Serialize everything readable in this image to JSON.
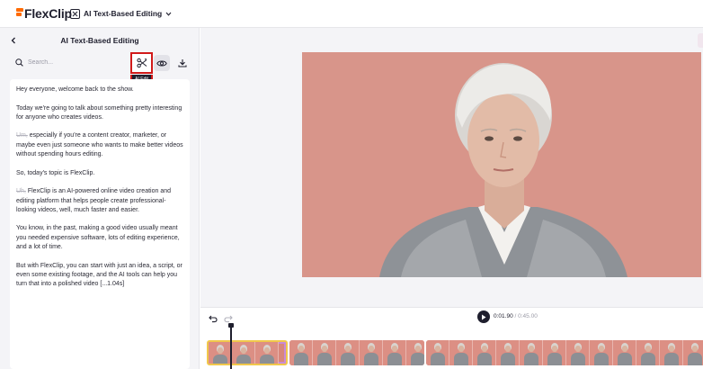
{
  "app": {
    "brand": "FlexClip",
    "tool_name": "AI Text-Based Editing",
    "brand_color": "#ff6a00"
  },
  "panel": {
    "title": "AI Text-Based Editing",
    "search_placeholder": "Search...",
    "ai_edit_tooltip": "AI Edit",
    "icons": [
      "back-icon",
      "search-icon",
      "scissors-icon",
      "eye-icon",
      "download-icon"
    ]
  },
  "transcript": [
    {
      "segments": [
        {
          "text": "Hey everyone, welcome back to the show.",
          "filler": false
        }
      ]
    },
    {
      "segments": [
        {
          "text": "Today we're going to talk about something pretty interesting for anyone who creates videos.",
          "filler": false
        }
      ]
    },
    {
      "segments": [
        {
          "text": "Um,",
          "filler": true
        },
        {
          "text": " especially if you're a content creator, marketer, or maybe even just someone who wants to make better videos without spending hours editing.",
          "filler": false
        }
      ]
    },
    {
      "segments": [
        {
          "text": "So, today's topic is FlexClip.",
          "filler": false
        }
      ]
    },
    {
      "segments": [
        {
          "text": "Uh,",
          "filler": true
        },
        {
          "text": " FlexClip is an AI-powered online video creation and editing platform that helps people create professional-looking videos, well, much faster and easier.",
          "filler": false
        }
      ]
    },
    {
      "segments": [
        {
          "text": "You know, in the past, making a good video usually meant you needed expensive software, lots of editing experience, and a lot of time.",
          "filler": false
        }
      ]
    },
    {
      "segments": [
        {
          "text": "But with FlexClip, you can start with just an idea, a script, or even some existing footage, and the AI tools can help you turn that into a polished video [...1.04s]",
          "filler": false
        }
      ]
    }
  ],
  "player": {
    "current_time": "0:01.90",
    "separator": "/",
    "total_time": "0:45.00"
  },
  "timeline": {
    "clips": [
      {
        "thumbs": 3,
        "selected": true
      },
      {
        "thumbs": 6,
        "selected": false
      },
      {
        "thumbs": 12,
        "selected": false
      }
    ]
  },
  "colors": {
    "video_background": "#d8958a",
    "highlight_border": "#d11a1a",
    "selected_clip_border": "#f1c84b"
  }
}
